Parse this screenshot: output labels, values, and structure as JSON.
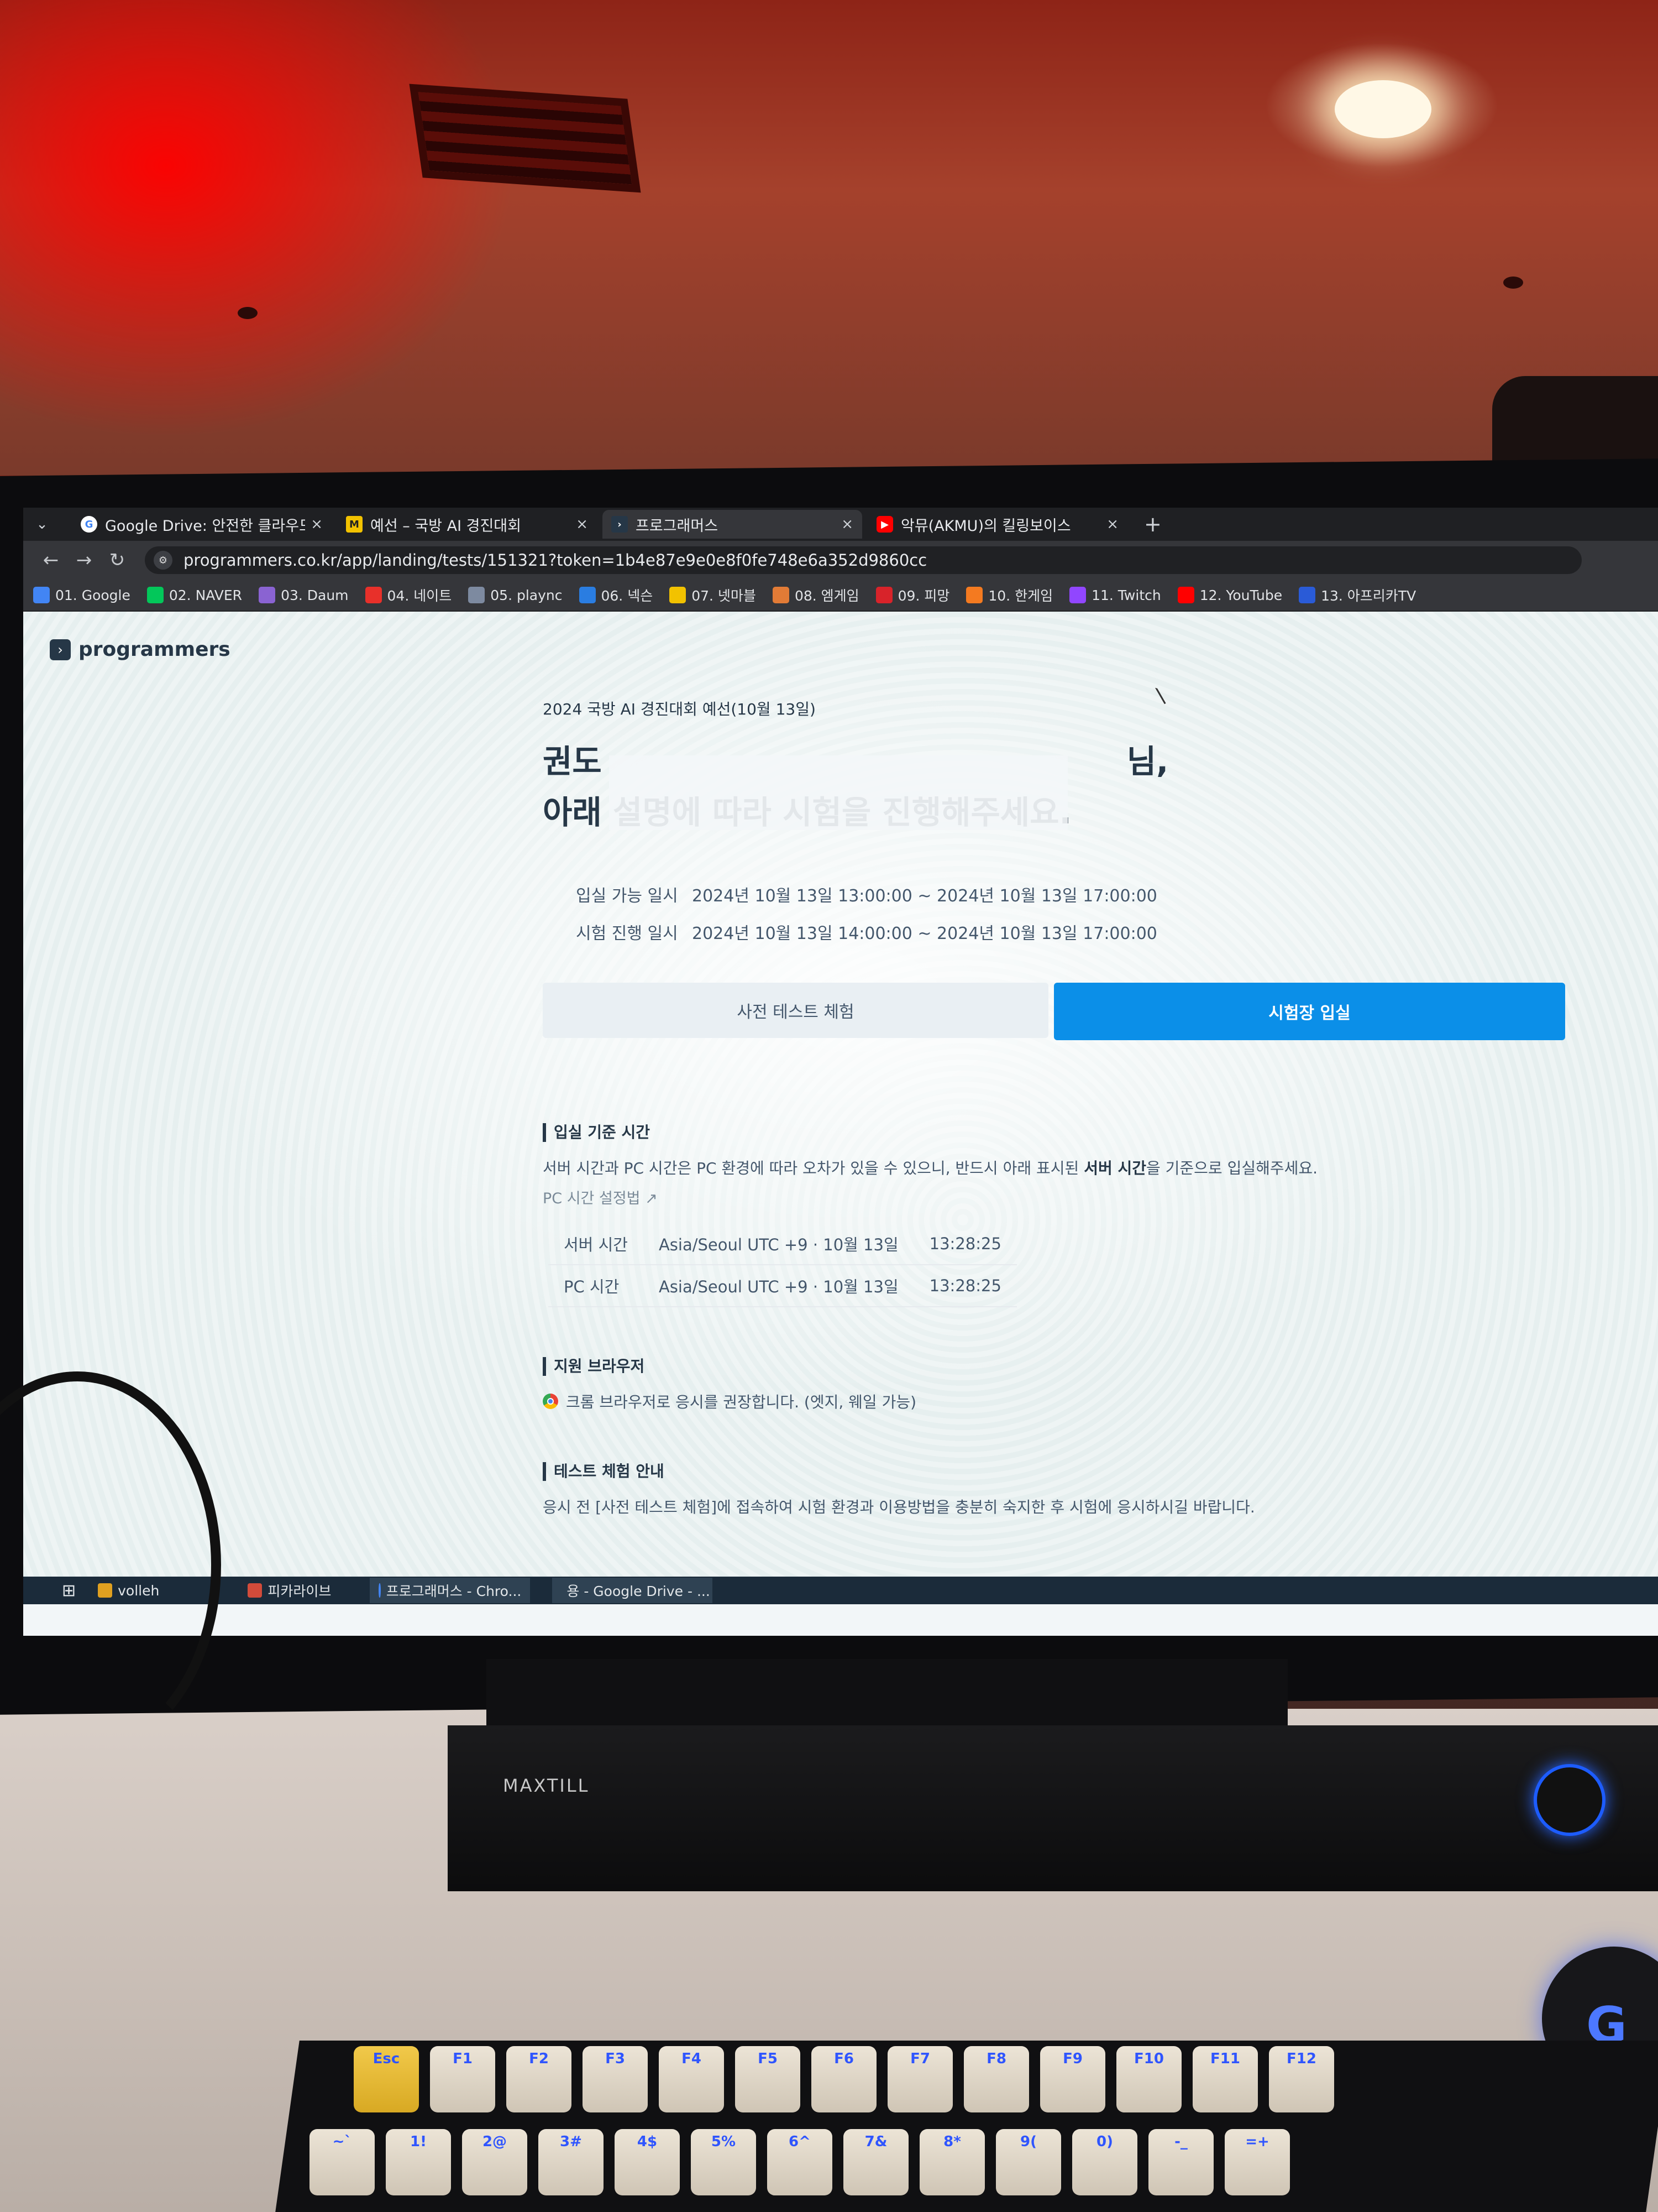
{
  "browser": {
    "tabs": [
      {
        "title": "Google Drive: 안전한 클라우드",
        "favicon": "google-icon",
        "active": false
      },
      {
        "title": "예선 – 국방 AI 경진대회",
        "favicon": "m-icon",
        "active": false
      },
      {
        "title": "프로그래머스",
        "favicon": "programmers-icon",
        "active": true
      },
      {
        "title": "악뮤(AKMU)의 킬링보이스",
        "favicon": "youtube-icon",
        "active": false
      }
    ],
    "close_glyph": "×",
    "new_tab_glyph": "+",
    "url": "programmers.co.kr/app/landing/tests/151321?token=1b4e87e9e0e8f0fe748e6a352d9860cc",
    "bookmarks": [
      {
        "label": "01. Google",
        "color": "#4285f4"
      },
      {
        "label": "02. NAVER",
        "color": "#03c75a"
      },
      {
        "label": "03. Daum",
        "color": "#8a63d2"
      },
      {
        "label": "04. 네이트",
        "color": "#e8302a"
      },
      {
        "label": "05. plaync",
        "color": "#7d8aa0"
      },
      {
        "label": "06. 넥슨",
        "color": "#2a7de1"
      },
      {
        "label": "07. 넷마블",
        "color": "#f2c200"
      },
      {
        "label": "08. 엠게임",
        "color": "#e27b36"
      },
      {
        "label": "09. 피망",
        "color": "#d8232a"
      },
      {
        "label": "10. 한게임",
        "color": "#f47a20"
      },
      {
        "label": "11. Twitch",
        "color": "#9146ff"
      },
      {
        "label": "12. YouTube",
        "color": "#ff0000"
      },
      {
        "label": "13. 아프리카TV",
        "color": "#2a5bd7"
      }
    ]
  },
  "page": {
    "logo_text": "programmers",
    "contest_name": "2024 국방 AI 경진대회 예선(10월 13일)",
    "greeting_line1_start": "권도",
    "greeting_line1_end": "님,",
    "greeting_line2": "아래 설명에 따라 시험을 진행해주세요.",
    "info": [
      {
        "label": "입실 가능 일시",
        "value": "2024년 10월 13일 13:00:00 ~ 2024년 10월 13일 17:00:00"
      },
      {
        "label": "시험 진행 일시",
        "value": "2024년 10월 13일 14:00:00 ~ 2024년 10월 13일 17:00:00"
      }
    ],
    "btn_pretest": "사전 테스트 체험",
    "btn_enter": "시험장 입실",
    "entry_section": {
      "title": "입실 기준 시간",
      "desc_before": "서버 시간과 PC 시간은 PC 환경에 따라 오차가 있을 수 있으니, 반드시 아래 표시된 ",
      "desc_bold": "서버 시간",
      "desc_after": "을 기준으로 입실해주세요.",
      "pc_link": "PC 시간 설정법 ↗",
      "rows": [
        {
          "label": "서버 시간",
          "zone": "Asia/Seoul UTC +9 · 10월 13일",
          "time": "13:28:25"
        },
        {
          "label": "PC 시간",
          "zone": "Asia/Seoul UTC +9 · 10월 13일",
          "time": "13:28:25"
        }
      ]
    },
    "browser_section": {
      "title": "지원 브라우저",
      "text": "크롬 브라우저로 응시를 권장합니다. (엣지, 웨일 가능)"
    },
    "test_section": {
      "title": "테스트 체험 안내",
      "text": "응시 전 [사전 테스트 체험]에 접속하여 시험 환경과 이용방법을 충분히 숙지한 후 시험에 응시하시길 바랍니다."
    }
  },
  "taskbar": {
    "items": [
      {
        "label": "volleh",
        "color": "#e0a020"
      },
      {
        "label": "피카라이브",
        "color": "#d24b3a"
      },
      {
        "label": "프로그래머스 - Chro...",
        "color": "#4285f4"
      },
      {
        "label": "용 - Google Drive - ...",
        "color": "#34a853"
      }
    ]
  },
  "hardware": {
    "soundbar_brand": "MAXTILL",
    "keys_row1": [
      "Esc",
      "F1",
      "F2",
      "F3",
      "F4",
      "F5",
      "F6",
      "F7",
      "F8",
      "F9",
      "F10",
      "F11",
      "F12"
    ],
    "keys_row2": [
      "~`",
      "1!",
      "2@",
      "3#",
      "4$",
      "5%",
      "6^",
      "7&",
      "8*",
      "9(",
      "0)",
      "-_",
      "=+"
    ]
  },
  "colors": {
    "primary_button": "#0b8fe8",
    "text_dark": "#263747",
    "browser_chrome": "#35363a"
  }
}
